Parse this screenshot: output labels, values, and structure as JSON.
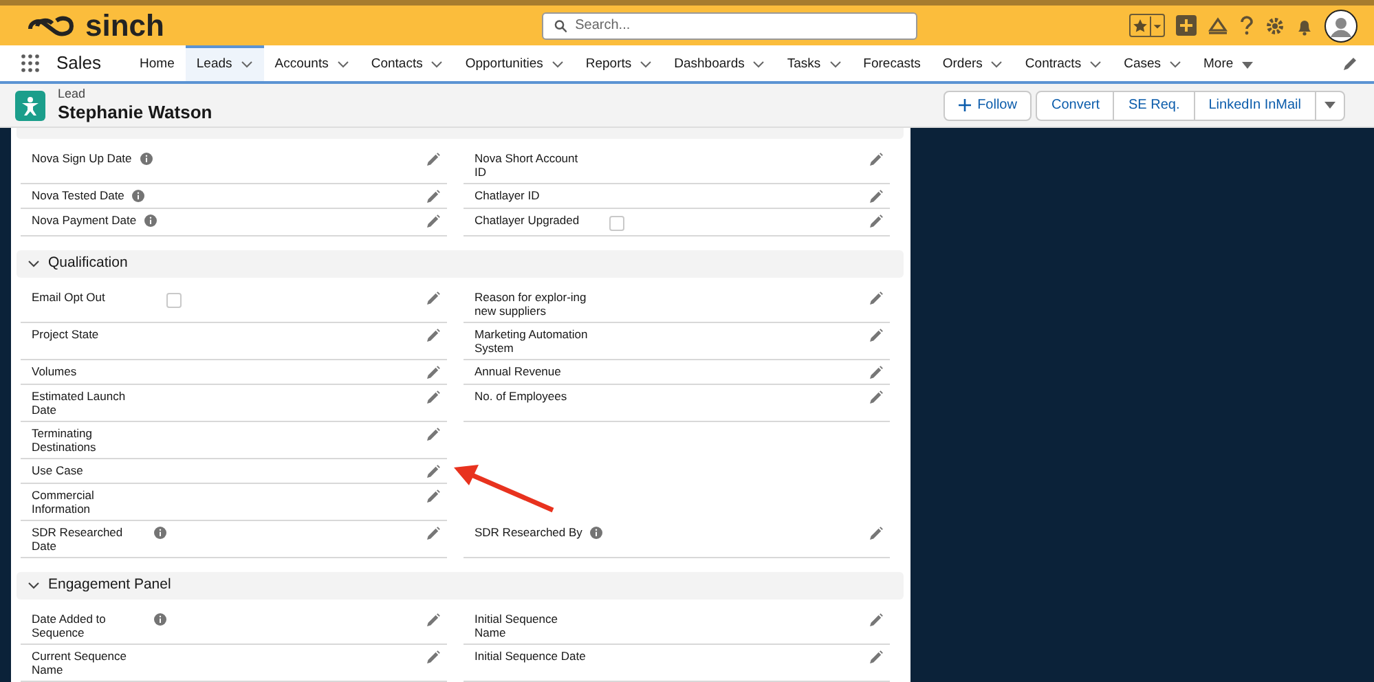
{
  "brand": {
    "name": "sinch"
  },
  "search": {
    "placeholder": "Search..."
  },
  "nav": {
    "app": "Sales",
    "items": [
      {
        "label": "Home",
        "kind": "tab",
        "selected": false
      },
      {
        "label": "Leads",
        "kind": "menu",
        "selected": true
      },
      {
        "label": "Accounts",
        "kind": "menu",
        "selected": false
      },
      {
        "label": "Contacts",
        "kind": "menu",
        "selected": false
      },
      {
        "label": "Opportunities",
        "kind": "menu",
        "selected": false
      },
      {
        "label": "Reports",
        "kind": "menu",
        "selected": false
      },
      {
        "label": "Dashboards",
        "kind": "menu",
        "selected": false
      },
      {
        "label": "Tasks",
        "kind": "menu",
        "selected": false
      },
      {
        "label": "Forecasts",
        "kind": "tab",
        "selected": false
      },
      {
        "label": "Orders",
        "kind": "menu",
        "selected": false
      },
      {
        "label": "Contracts",
        "kind": "menu",
        "selected": false
      },
      {
        "label": "Cases",
        "kind": "menu",
        "selected": false
      },
      {
        "label": "More",
        "kind": "more",
        "selected": false
      }
    ]
  },
  "record": {
    "type": "Lead",
    "name": "Stephanie Watson",
    "actions": [
      {
        "label": "Follow",
        "kind": "follow"
      },
      {
        "label": "Convert",
        "kind": "action"
      },
      {
        "label": "SE Req.",
        "kind": "action"
      },
      {
        "label": "LinkedIn InMail",
        "kind": "action"
      }
    ]
  },
  "sections": [
    {
      "rows": [
        {
          "left": {
            "label": "Nova Sign Up Date",
            "info": true
          },
          "right": {
            "label": "Nova Short Account ID",
            "info": false
          }
        },
        {
          "left": {
            "label": "Nova Tested Date",
            "info": true
          },
          "right": {
            "label": "Chatlayer ID",
            "info": false
          }
        },
        {
          "left": {
            "label": "Nova Payment Date",
            "info": true
          },
          "right": {
            "label": "Chatlayer Upgraded",
            "info": false,
            "checked": false
          }
        }
      ]
    },
    {
      "title": "Qualification",
      "expanded": true,
      "rows": [
        {
          "left": {
            "label": "Email Opt Out",
            "info": false,
            "checked": false
          },
          "right": {
            "label": "Reason for explor-ing new suppliers",
            "info": false
          }
        },
        {
          "left": {
            "label": "Project State",
            "info": false
          },
          "right": {
            "label": "Marketing Automation System",
            "info": false
          }
        },
        {
          "left": {
            "label": "Volumes",
            "info": false
          },
          "right": {
            "label": "Annual Revenue",
            "info": false
          }
        },
        {
          "left": {
            "label": "Estimated Launch Date",
            "info": false
          },
          "right": {
            "label": "No. of Employees",
            "info": false
          }
        },
        {
          "left": {
            "label": "Terminating Destinations",
            "info": false
          }
        },
        {
          "left": {
            "label": "Use Case",
            "info": false
          }
        },
        {
          "left": {
            "label": "Commercial Information",
            "info": false
          }
        },
        {
          "left": {
            "label": "SDR Researched Date",
            "info": true
          },
          "right": {
            "label": "SDR Researched By",
            "info": true
          }
        }
      ]
    },
    {
      "title": "Engagement Panel",
      "expanded": true,
      "rows": [
        {
          "left": {
            "label": "Date Added to Sequence",
            "info": true
          },
          "right": {
            "label": "Initial Sequence Name",
            "info": false
          }
        },
        {
          "left": {
            "label": "Current Sequence Name",
            "info": false
          },
          "right": {
            "label": "Initial Sequence Date",
            "info": false
          }
        }
      ]
    }
  ]
}
